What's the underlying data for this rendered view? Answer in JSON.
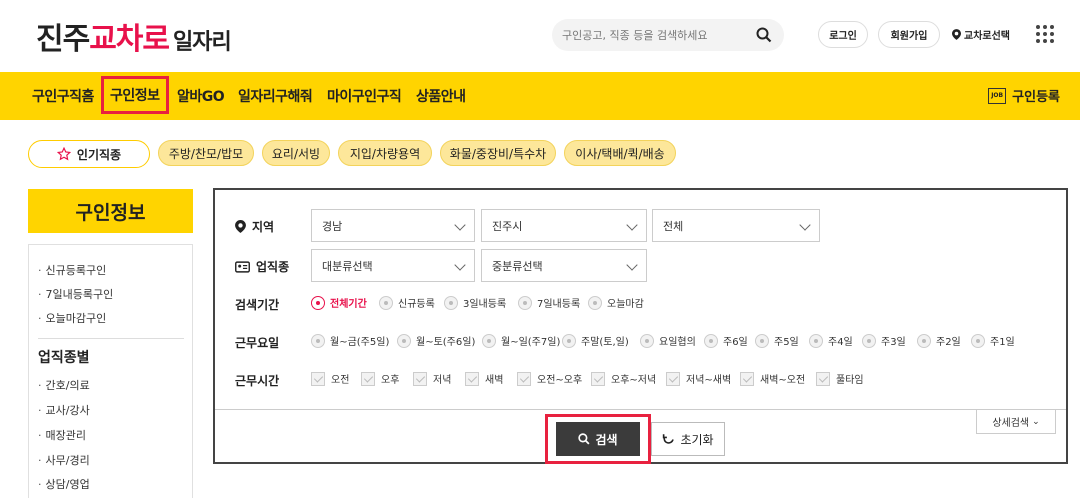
{
  "header": {
    "logo": {
      "part1": "진주",
      "part2": "교차로",
      "part3": "일자리"
    },
    "search_placeholder": "구인공고, 직종 등을 검색하세요",
    "login": "로그인",
    "join": "회원가입",
    "region": "교차로선택"
  },
  "nav": {
    "items": [
      "구인구직홈",
      "구인정보",
      "알바GO",
      "일자리구해줘",
      "마이구인구직",
      "상품안내"
    ],
    "active": "구인정보",
    "post_label": "구인등록",
    "post_icon_text": "JOB"
  },
  "popular": {
    "title": "인기직종",
    "tags": [
      "주방/찬모/밥모",
      "요리/서빙",
      "지입/차량용역",
      "화물/중장비/특수차",
      "이사/택배/퀵/배송"
    ]
  },
  "sidebar": {
    "title": "구인정보",
    "links": [
      "신규등록구인",
      "7일내등록구인",
      "오늘마감구인"
    ],
    "section": "업직종별",
    "section_links": [
      "간호/의료",
      "교사/강사",
      "매장관리",
      "사무/경리",
      "상담/영업"
    ]
  },
  "panel": {
    "region_label": "지역",
    "region_selects": [
      "경남",
      "진주시",
      "전체"
    ],
    "job_label": "업직종",
    "job_selects": [
      "대분류선택",
      "중분류선택"
    ],
    "period_label": "검색기간",
    "period_options": [
      "전체기간",
      "신규등록",
      "3일내등록",
      "7일내등록",
      "오늘마감"
    ],
    "day_label": "근무요일",
    "day_options": [
      "월~금(주5일)",
      "월~토(주6일)",
      "월~일(주7일)",
      "주말(토,일)",
      "요일협의",
      "주6일",
      "주5일",
      "주4일",
      "주3일",
      "주2일",
      "주1일"
    ],
    "time_label": "근무시간",
    "time_options": [
      "오전",
      "오후",
      "저녁",
      "새벽",
      "오전~오후",
      "오후~저녁",
      "저녁~새벽",
      "새벽~오전",
      "풀타임"
    ],
    "detail": "상세검색",
    "search": "검색",
    "reset": "초기화"
  }
}
